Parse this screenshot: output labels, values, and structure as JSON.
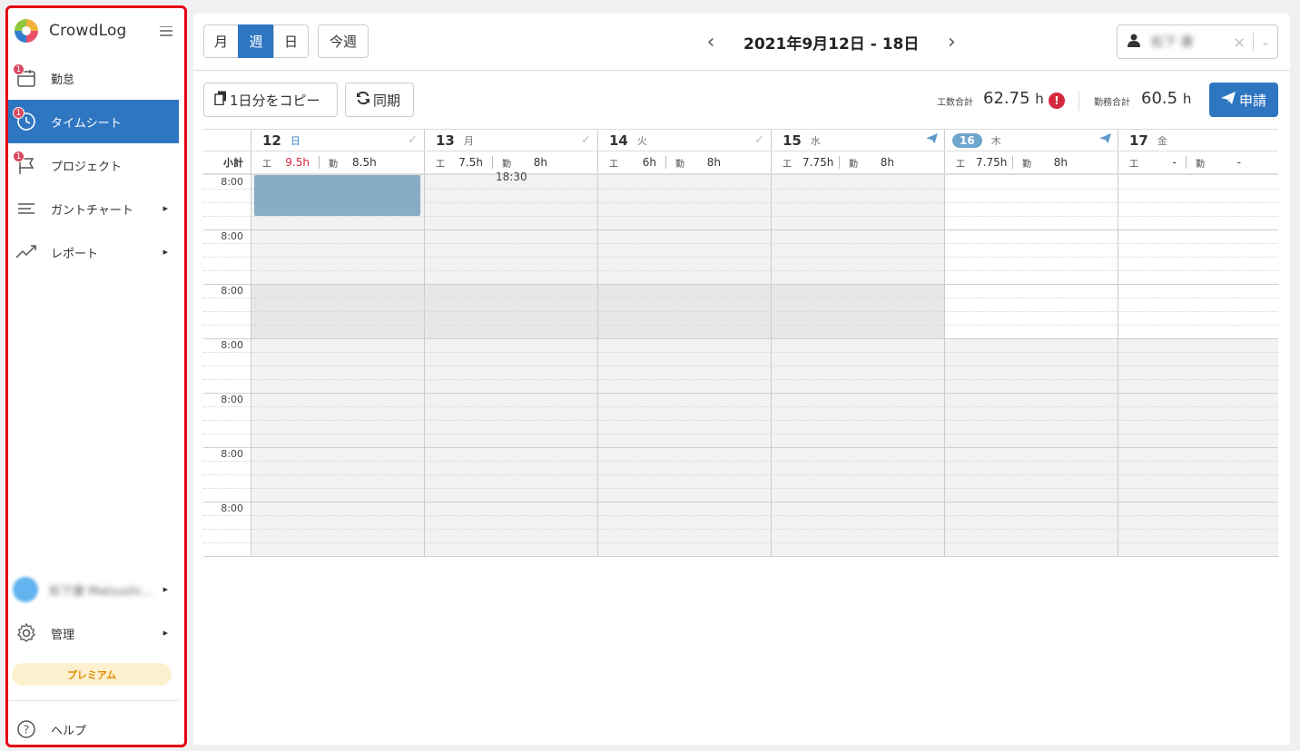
{
  "app": {
    "name": "CrowdLog"
  },
  "sidebar": {
    "items": [
      {
        "label": "勤怠",
        "badge": "1"
      },
      {
        "label": "タイムシート",
        "badge": "1",
        "active": true
      },
      {
        "label": "プロジェクト",
        "badge": "1"
      },
      {
        "label": "ガントチャート"
      },
      {
        "label": "レポート"
      }
    ],
    "user": {
      "name": "松下康 Matsushi..."
    },
    "admin": {
      "label": "管理"
    },
    "premium": "プレミアム",
    "help": "ヘルプ"
  },
  "header": {
    "views": [
      "月",
      "週",
      "日"
    ],
    "active_view": "週",
    "today": "今週",
    "date_range": "2021年9月12日 - 18日",
    "user_select": {
      "value": "松下 康"
    }
  },
  "toolbar": {
    "copy_label": "1日分をコピー",
    "sync_label": "同期",
    "work_total_label": "工数合計",
    "work_total_value": "62.75",
    "work_total_unit": "h",
    "duty_total_label": "勤務合計",
    "duty_total_value": "60.5",
    "duty_total_unit": "h",
    "apply_label": "申請"
  },
  "calendar": {
    "subtotal_label": "小計",
    "koshu_key": "工",
    "kinmu_key": "勤",
    "days": [
      {
        "date": "12",
        "weekday": "日",
        "work": "9.5h",
        "duty": "8.5h",
        "status": "approved-icon"
      },
      {
        "date": "13",
        "weekday": "月",
        "work": "7.5h",
        "duty": "8h",
        "status": "approved-icon"
      },
      {
        "date": "14",
        "weekday": "火",
        "work": "6h",
        "duty": "8h",
        "status": "approved-icon"
      },
      {
        "date": "15",
        "weekday": "水",
        "work": "7.75h",
        "duty": "8h",
        "status": "submitted-icon"
      },
      {
        "date": "16",
        "weekday": "木",
        "work": "7.75h",
        "duty": "8h",
        "status": "submitted-icon",
        "today": true
      },
      {
        "date": "17",
        "weekday": "金",
        "work": "-",
        "duty": "-"
      }
    ],
    "time_labels": [
      "8:00",
      "8:00",
      "8:00",
      "8:00",
      "8:00",
      "8:00",
      "8:00"
    ],
    "event_time": "18:30"
  },
  "colors": {
    "accent": "#2f76c2",
    "highlight_frame": "#e60012",
    "event": "#86adc4",
    "warning": "#d4283f"
  }
}
